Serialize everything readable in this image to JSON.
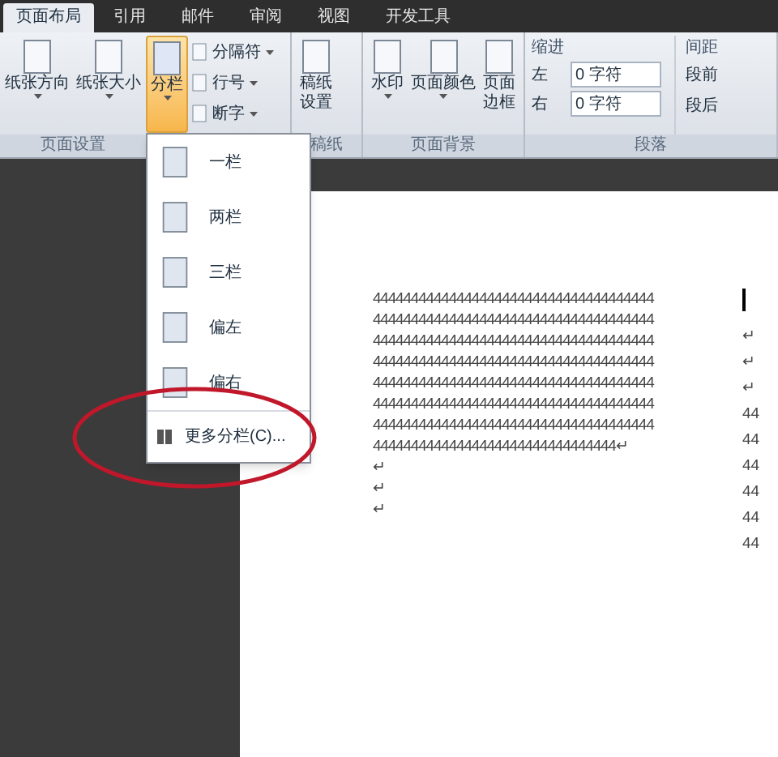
{
  "tabs": [
    {
      "label": "页面布局",
      "selected": true
    },
    {
      "label": "引用",
      "selected": false
    },
    {
      "label": "邮件",
      "selected": false
    },
    {
      "label": "审阅",
      "selected": false
    },
    {
      "label": "视图",
      "selected": false
    },
    {
      "label": "开发工具",
      "selected": false
    }
  ],
  "ribbon": {
    "groups": [
      {
        "label": "页面设置",
        "items": [
          {
            "kind": "large",
            "label": "纸张方向",
            "dropdown": true,
            "pressed": false
          },
          {
            "kind": "large",
            "label": "纸张大小",
            "dropdown": true,
            "pressed": false
          },
          {
            "kind": "large",
            "label": "分栏",
            "dropdown": true,
            "pressed": true
          },
          {
            "kind": "small",
            "label": "分隔符"
          },
          {
            "kind": "small",
            "label": "行号"
          },
          {
            "kind": "small",
            "label": "断字"
          }
        ]
      },
      {
        "label": "稿纸",
        "items": [
          {
            "kind": "narrow",
            "label": "稿纸设置",
            "dropdown": false,
            "pressed": false
          }
        ]
      },
      {
        "label": "页面背景",
        "items": [
          {
            "kind": "large",
            "label": "水印",
            "dropdown": true,
            "pressed": false
          },
          {
            "kind": "large",
            "label": "页面颜色",
            "dropdown": true,
            "pressed": false
          },
          {
            "kind": "narrow",
            "label": "页面边框",
            "dropdown": false,
            "pressed": false
          }
        ]
      },
      {
        "label": "段落",
        "indent": {
          "label": "缩进",
          "fields": [
            {
              "label": "左",
              "value": "0 字符"
            },
            {
              "label": "右",
              "value": "0 字符"
            }
          ]
        },
        "spacing": {
          "label": "间距",
          "items": [
            {
              "label": "段前"
            },
            {
              "label": "段后"
            }
          ]
        }
      }
    ]
  },
  "menu": {
    "items": [
      {
        "kind": "column",
        "label": "一栏"
      },
      {
        "kind": "column",
        "label": "两栏"
      },
      {
        "kind": "column",
        "label": "三栏"
      },
      {
        "kind": "column",
        "label": "偏左"
      },
      {
        "kind": "column",
        "label": "偏右"
      },
      {
        "kind": "more",
        "label": "更多分栏(C)..."
      }
    ]
  },
  "document": {
    "left_column": [
      "4444444444444444444444444444444444444",
      "4444444444444444444444444444444444444",
      "4444444444444444444444444444444444444",
      "4444444444444444444444444444444444444",
      "4444444444444444444444444444444444444",
      "4444444444444444444444444444444444444",
      "4444444444444444444444444444444444444",
      "44444444444444444444444444444444↵",
      "↵",
      "↵",
      "↵"
    ],
    "right_column": [
      "↵",
      "↵",
      "↵",
      "44",
      "44",
      "44",
      "44",
      "44",
      "44"
    ]
  }
}
